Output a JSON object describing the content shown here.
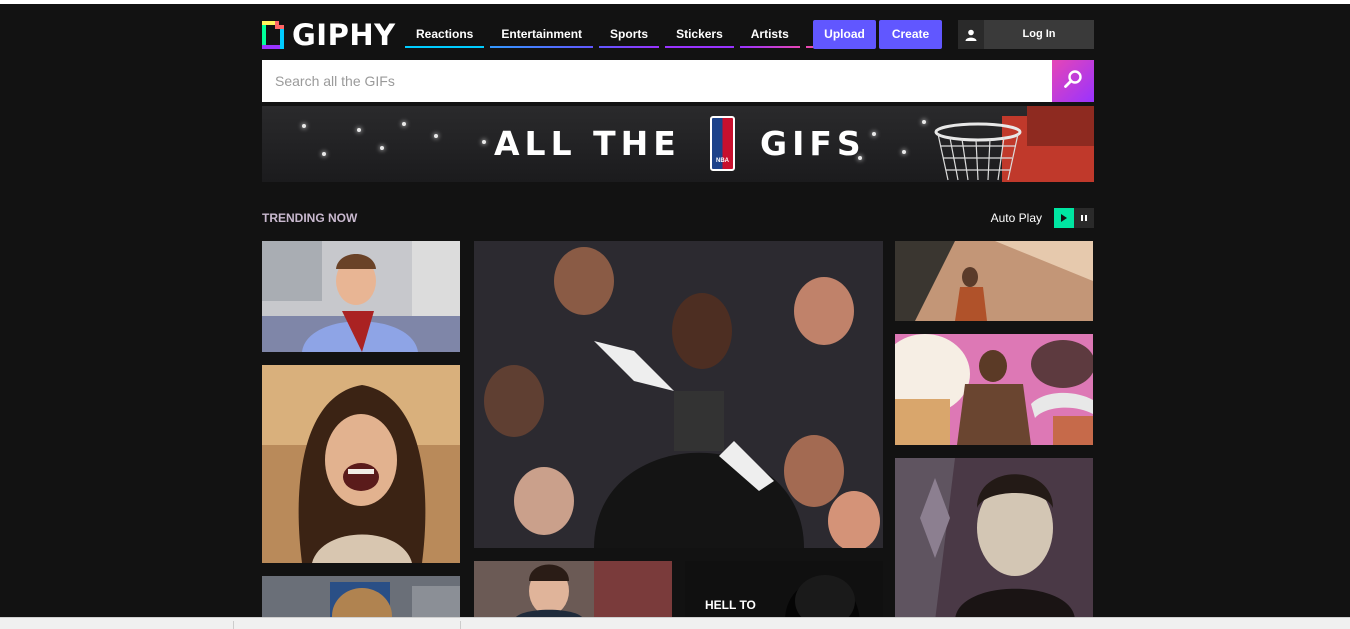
{
  "brand": {
    "name": "GIPHY"
  },
  "nav": {
    "items": [
      {
        "label": "Reactions",
        "color": "#00ccff"
      },
      {
        "label": "Entertainment",
        "color": "#6157ff"
      },
      {
        "label": "Sports",
        "color": "#9933ff"
      },
      {
        "label": "Stickers",
        "color": "#9933ff"
      },
      {
        "label": "Artists",
        "color": "#e646b6"
      }
    ],
    "more_icon": "vertical-dots-icon"
  },
  "actions": {
    "upload_label": "Upload",
    "create_label": "Create",
    "login_label": "Log In",
    "user_icon": "user-icon"
  },
  "search": {
    "placeholder": "Search all the GIFs",
    "icon": "search-icon"
  },
  "banner": {
    "left_text": "ALL THE",
    "right_text": "GIFS",
    "logo_text": "NBA"
  },
  "trending": {
    "title": "TRENDING NOW",
    "autoplay_label": "Auto Play",
    "play_icon": "play-icon",
    "pause_icon": "pause-icon"
  },
  "gifs": {
    "caption": "HELL TO"
  },
  "colors": {
    "accent": "#6157ff",
    "search_gradient_start": "#e646b6",
    "search_gradient_end": "#9933ff",
    "play_green": "#00e6a2"
  }
}
